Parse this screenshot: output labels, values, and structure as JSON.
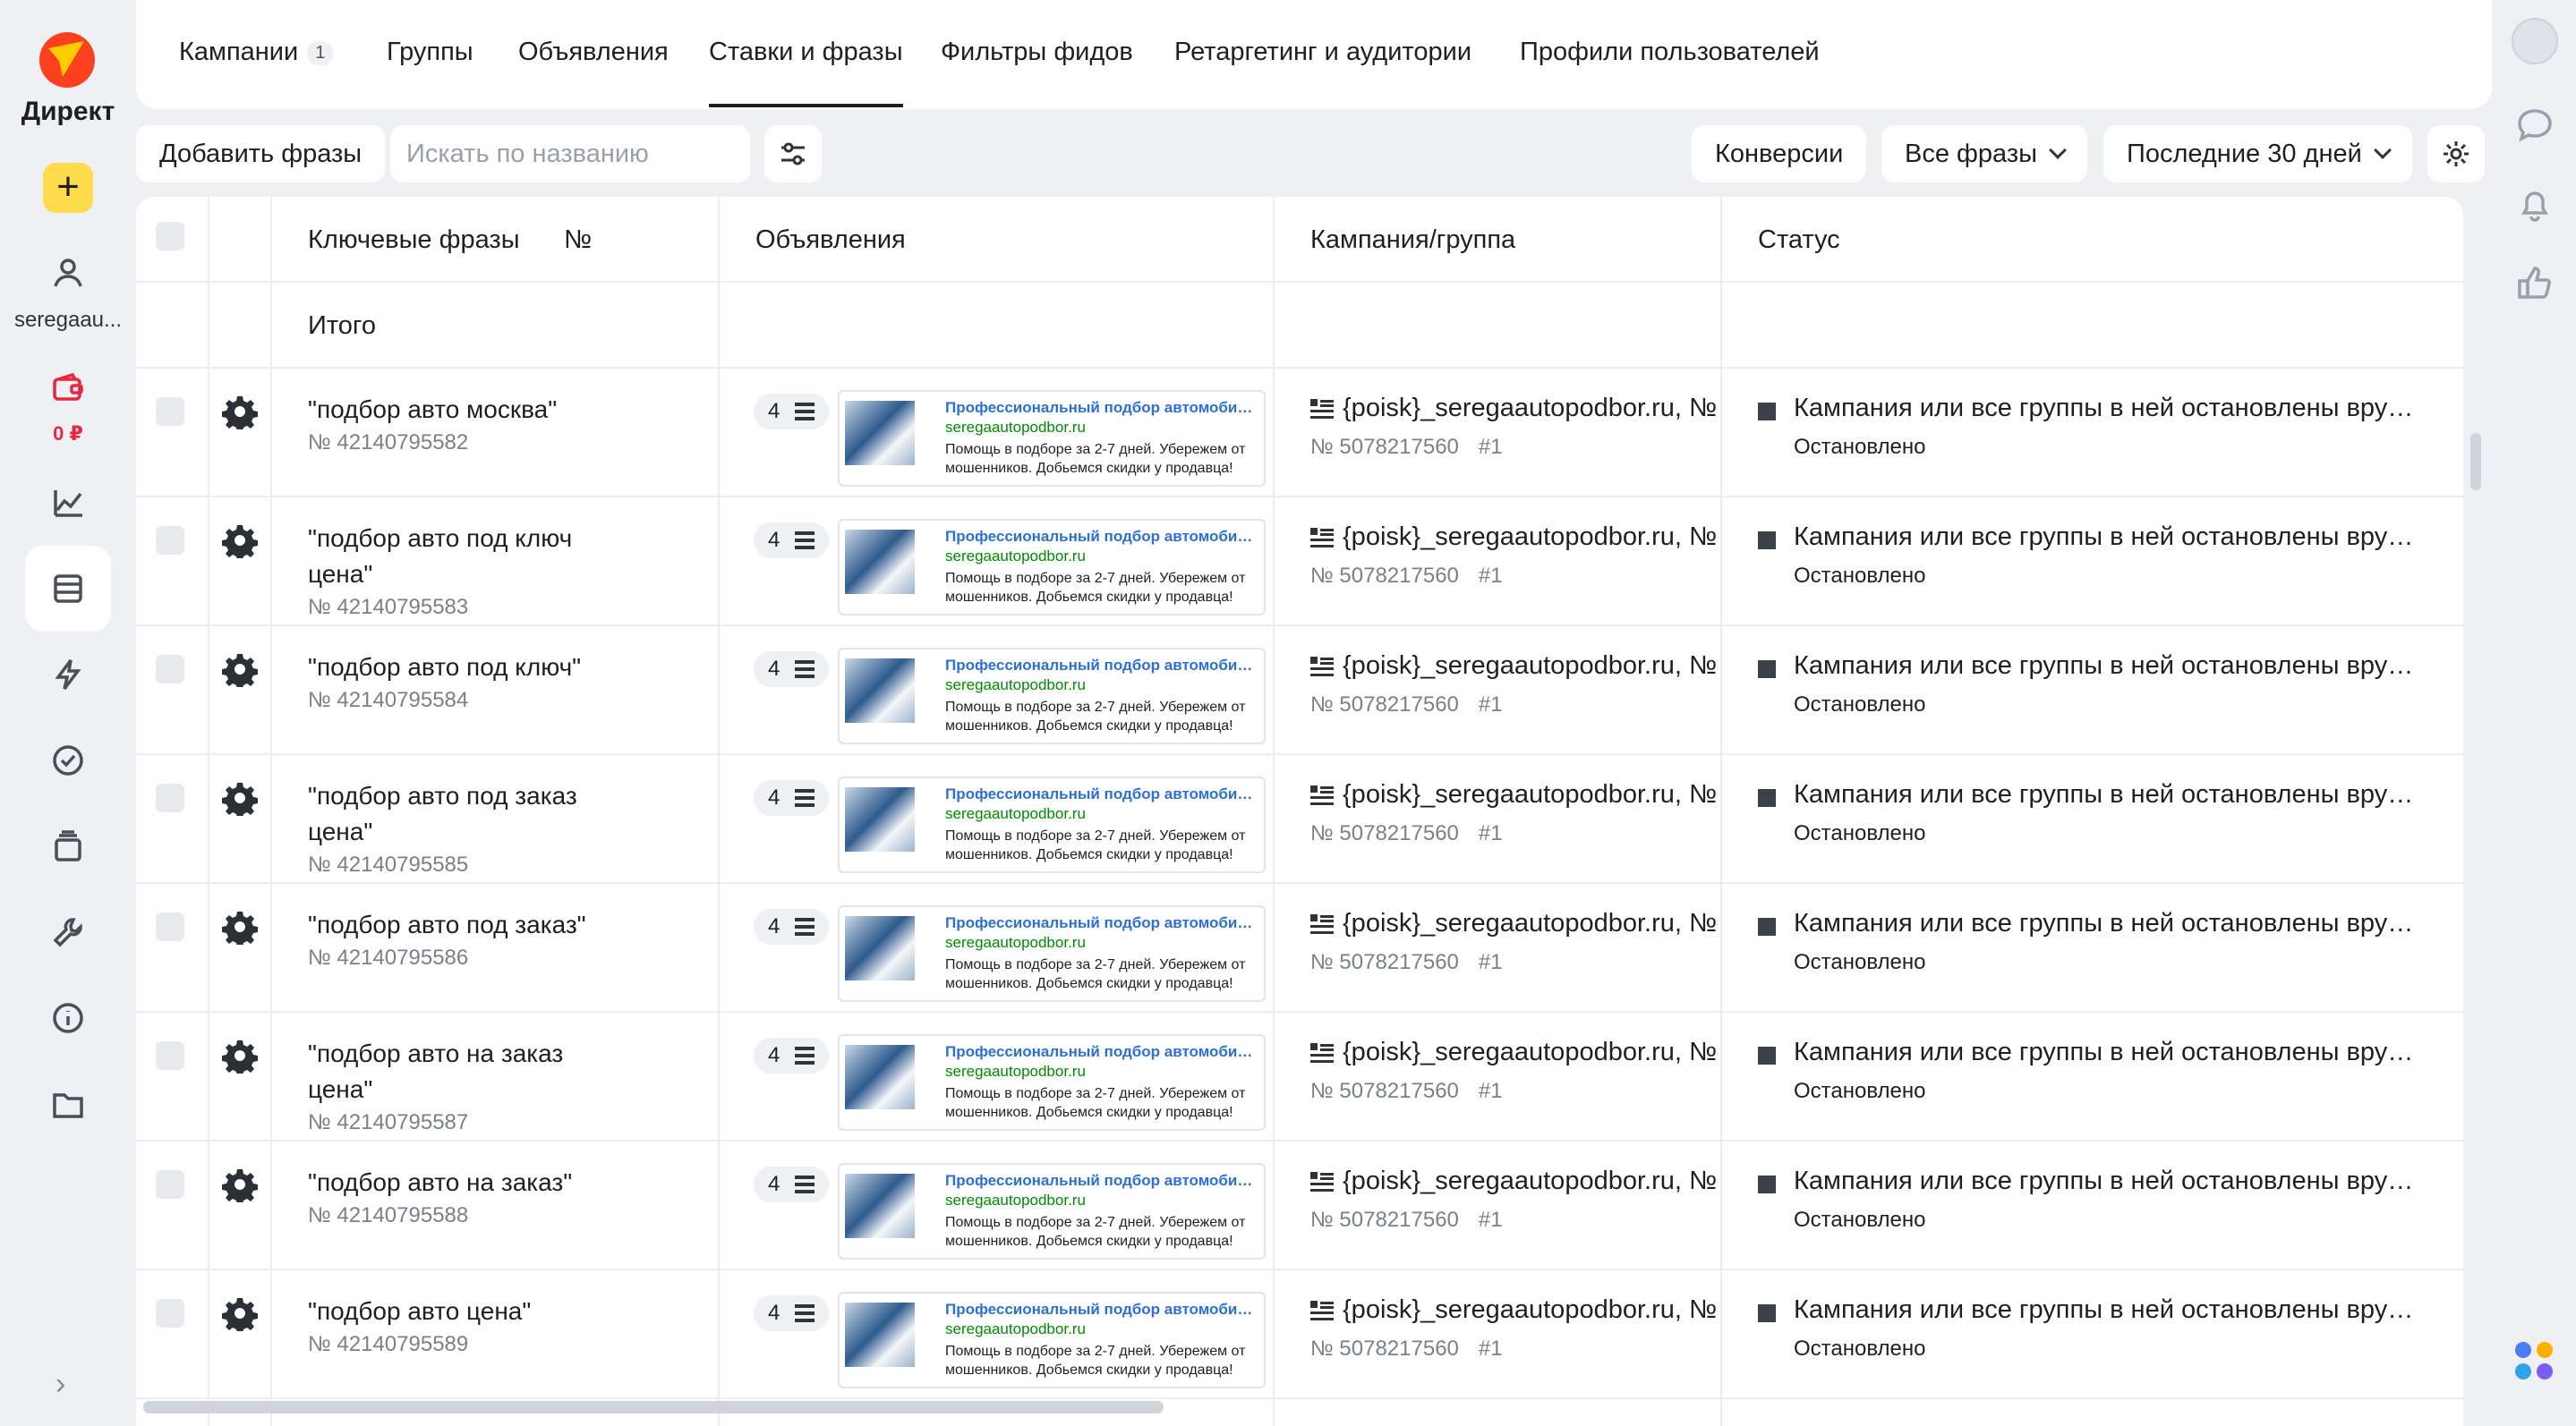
{
  "brand": {
    "logo_text": "Директ"
  },
  "rail": {
    "user_label": "seregaau...",
    "balance": "0 ₽"
  },
  "tabs": [
    {
      "label": "Кампании",
      "badge": "1"
    },
    {
      "label": "Группы"
    },
    {
      "label": "Объявления"
    },
    {
      "label": "Ставки и фразы",
      "active": true
    },
    {
      "label": "Фильтры фидов"
    },
    {
      "label": "Ретаргетинг и аудитории"
    },
    {
      "label": "Профили пользователей"
    }
  ],
  "toolbar": {
    "add_phrases": "Добавить фразы",
    "search_placeholder": "Искать по названию",
    "conversions": "Конверсии",
    "phrase_filter": "Все фразы",
    "period": "Последние 30 дней"
  },
  "table": {
    "headers": {
      "keywords": "Ключевые фразы",
      "number": "№",
      "ads": "Объявления",
      "campaign": "Кампания/группа",
      "status": "Статус"
    },
    "total_label": "Итого",
    "rows": [
      {
        "phrase": "\"подбор авто москва\"",
        "id": "№ 42140795582",
        "ads_count": "4",
        "campaign": "{poisk}_seregaautopodbor.ru, №",
        "campaign_id": "№ 5078217560",
        "group": "#1",
        "status": "Кампания или все группы в ней остановлены вручную",
        "status_sub": "Остановлено"
      },
      {
        "phrase": "\"подбор авто под ключ цена\"",
        "id": "№ 42140795583",
        "ads_count": "4",
        "campaign": "{poisk}_seregaautopodbor.ru, №",
        "campaign_id": "№ 5078217560",
        "group": "#1",
        "status": "Кампания или все группы в ней остановлены вручную",
        "status_sub": "Остановлено"
      },
      {
        "phrase": "\"подбор авто под ключ\"",
        "id": "№ 42140795584",
        "ads_count": "4",
        "campaign": "{poisk}_seregaautopodbor.ru, №",
        "campaign_id": "№ 5078217560",
        "group": "#1",
        "status": "Кампания или все группы в ней остановлены вручную",
        "status_sub": "Остановлено"
      },
      {
        "phrase": "\"подбор авто под заказ цена\"",
        "id": "№ 42140795585",
        "ads_count": "4",
        "campaign": "{poisk}_seregaautopodbor.ru, №",
        "campaign_id": "№ 5078217560",
        "group": "#1",
        "status": "Кампания или все группы в ней остановлены вручную",
        "status_sub": "Остановлено"
      },
      {
        "phrase": "\"подбор авто под заказ\"",
        "id": "№ 42140795586",
        "ads_count": "4",
        "campaign": "{poisk}_seregaautopodbor.ru, №",
        "campaign_id": "№ 5078217560",
        "group": "#1",
        "status": "Кампания или все группы в ней остановлены вручную",
        "status_sub": "Остановлено"
      },
      {
        "phrase": "\"подбор авто на заказ цена\"",
        "id": "№ 42140795587",
        "ads_count": "4",
        "campaign": "{poisk}_seregaautopodbor.ru, №",
        "campaign_id": "№ 5078217560",
        "group": "#1",
        "status": "Кампания или все группы в ней остановлены вручную",
        "status_sub": "Остановлено"
      },
      {
        "phrase": "\"подбор авто на заказ\"",
        "id": "№ 42140795588",
        "ads_count": "4",
        "campaign": "{poisk}_seregaautopodbor.ru, №",
        "campaign_id": "№ 5078217560",
        "group": "#1",
        "status": "Кампания или все группы в ней остановлены вручную",
        "status_sub": "Остановлено"
      },
      {
        "phrase": "\"подбор авто цена\"",
        "id": "№ 42140795589",
        "ads_count": "4",
        "campaign": "{poisk}_seregaautopodbor.ru, №",
        "campaign_id": "№ 5078217560",
        "group": "#1",
        "status": "Кампания или все группы в ней остановлены вручную",
        "status_sub": "Остановлено"
      }
    ]
  },
  "ad_preview": {
    "title": "Профессиональный подбор автомобиля с пр...",
    "url": "seregaautopodbor.ru",
    "desc": "Помощь в подборе за 2-7 дней. Убережем от мошенников. Добьемся скидки у продавца!"
  }
}
